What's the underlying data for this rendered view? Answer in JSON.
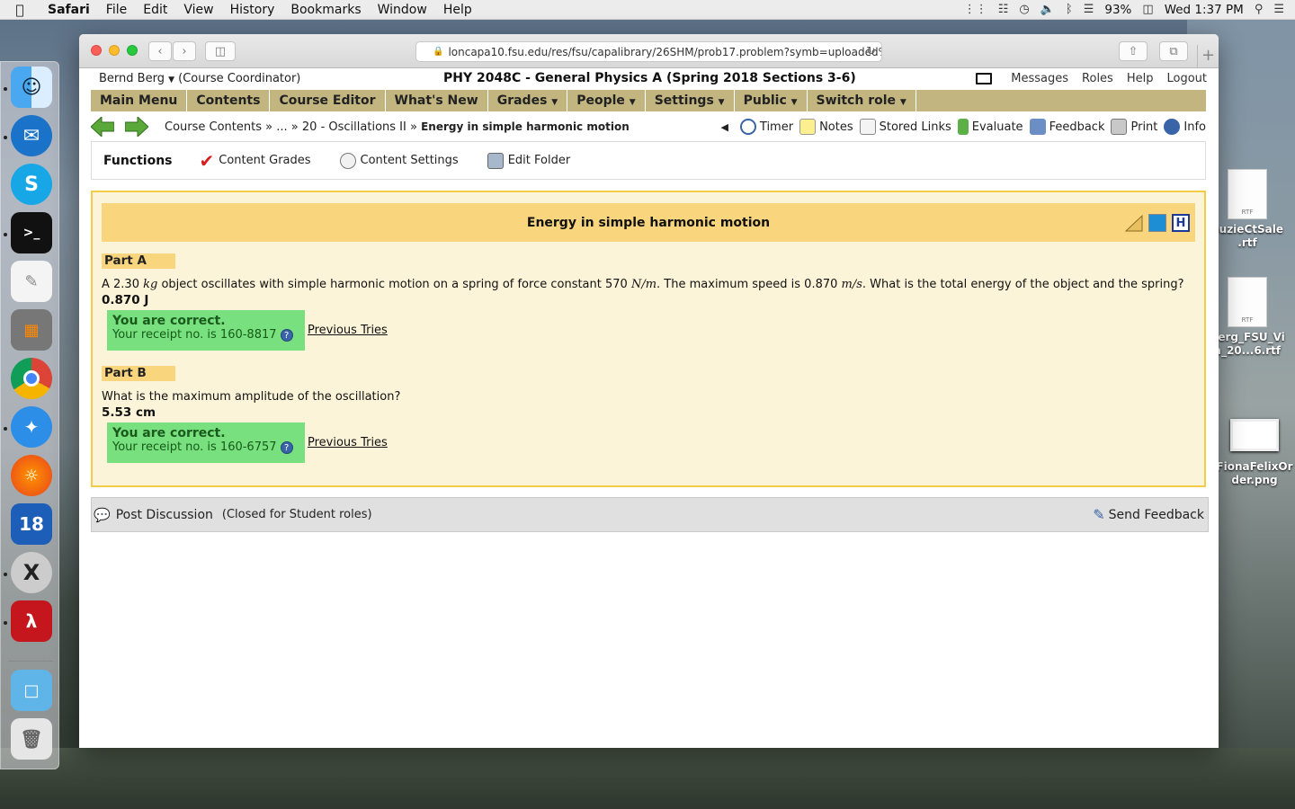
{
  "menubar": {
    "app_name": "Safari",
    "items": [
      "File",
      "Edit",
      "View",
      "History",
      "Bookmarks",
      "Window",
      "Help"
    ],
    "battery": "93%",
    "clock": "Wed 1:37 PM"
  },
  "browser": {
    "url": "loncapa10.fsu.edu/res/fsu/capalibrary/26SHM/prob17.problem?symb=uploaded%"
  },
  "header": {
    "user": "Bernd Berg",
    "role": "(Course Coordinator)",
    "course": "PHY 2048C - General Physics A (Spring 2018 Sections 3-6)",
    "links": [
      "Messages",
      "Roles",
      "Help",
      "Logout"
    ]
  },
  "main_menu": [
    {
      "label": "Main Menu",
      "dropdown": false
    },
    {
      "label": "Contents",
      "dropdown": false
    },
    {
      "label": "Course Editor",
      "dropdown": false
    },
    {
      "label": "What's New",
      "dropdown": false
    },
    {
      "label": "Grades",
      "dropdown": true
    },
    {
      "label": "People",
      "dropdown": true
    },
    {
      "label": "Settings",
      "dropdown": true
    },
    {
      "label": "Public",
      "dropdown": true
    },
    {
      "label": "Switch role",
      "dropdown": true
    }
  ],
  "breadcrumb": {
    "c1": "Course Contents",
    "c2": "...",
    "c3": "20 - Oscillations II",
    "current": "Energy in simple harmonic motion",
    "sep": "»"
  },
  "nav_tools": [
    "Timer",
    "Notes",
    "Stored Links",
    "Evaluate",
    "Feedback",
    "Print",
    "Info"
  ],
  "functions": {
    "title": "Functions",
    "items": [
      "Content Grades",
      "Content Settings",
      "Edit Folder"
    ]
  },
  "problem": {
    "title": "Energy in simple harmonic motion",
    "part_a": {
      "label": "Part A",
      "q_pre": "A 2.30 ",
      "q_u1": "kg",
      "q_mid1": " object oscillates with simple harmonic motion on a spring of force constant 570 ",
      "q_u2": "N/m",
      "q_mid2": ". The maximum speed is 0.870 ",
      "q_u3": "m/s",
      "q_post": ". What is the total energy of the object and the spring?",
      "answer": "0.870 J",
      "status": "You are correct.",
      "receipt": "Your receipt no. is 160-8817",
      "prev": "Previous Tries"
    },
    "part_b": {
      "label": "Part B",
      "question": "What is the maximum amplitude of the oscillation?",
      "answer": "5.53 cm",
      "status": "You are correct.",
      "receipt": "Your receipt no. is 160-6757",
      "prev": "Previous Tries"
    }
  },
  "discussion": {
    "post": "Post Discussion",
    "closed": "(Closed for Student roles)",
    "send": "Send Feedback"
  },
  "desktop_files": [
    {
      "tag": "RTF",
      "line1": "SuzieCtSale",
      "line2": ".rtf"
    },
    {
      "tag": "RTF",
      "line1": "Berg_FSU_Vi",
      "line2": "a_20...6.rtf"
    },
    {
      "tag": "",
      "line1": "FionaFelixOr",
      "line2": "der.png"
    }
  ]
}
